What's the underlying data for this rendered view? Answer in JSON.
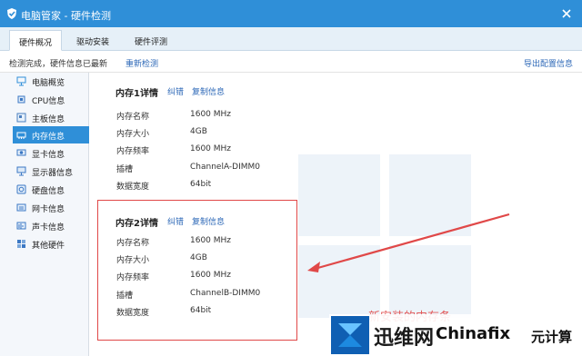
{
  "app": {
    "title": "电脑管家 - 硬件检测"
  },
  "tabs": [
    {
      "label": "硬件概况",
      "active": true
    },
    {
      "label": "驱动安装",
      "active": false
    },
    {
      "label": "硬件评测",
      "active": false
    }
  ],
  "status": {
    "text": "检测完成，硬件信息已最新",
    "rescan": "重新检测",
    "export": "导出配置信息"
  },
  "sidebar": {
    "items": [
      {
        "label": "电脑概览",
        "icon": "computer-icon"
      },
      {
        "label": "CPU信息",
        "icon": "cpu-icon"
      },
      {
        "label": "主板信息",
        "icon": "motherboard-icon"
      },
      {
        "label": "内存信息",
        "icon": "memory-icon",
        "active": true
      },
      {
        "label": "显卡信息",
        "icon": "gpu-icon"
      },
      {
        "label": "显示器信息",
        "icon": "monitor-icon"
      },
      {
        "label": "硬盘信息",
        "icon": "disk-icon"
      },
      {
        "label": "网卡信息",
        "icon": "network-card-icon"
      },
      {
        "label": "声卡信息",
        "icon": "sound-card-icon"
      },
      {
        "label": "其他硬件",
        "icon": "other-hardware-icon"
      }
    ]
  },
  "memory": [
    {
      "title": "内存1详情",
      "actions": {
        "correct": "纠错",
        "copy": "复制信息"
      },
      "rows": [
        {
          "label": "内存名称",
          "value": "1600 MHz"
        },
        {
          "label": "内存大小",
          "value": "4GB"
        },
        {
          "label": "内存频率",
          "value": "1600 MHz"
        },
        {
          "label": "插槽",
          "value": "ChannelA-DIMM0"
        },
        {
          "label": "数据宽度",
          "value": "64bit"
        }
      ]
    },
    {
      "title": "内存2详情",
      "actions": {
        "correct": "纠错",
        "copy": "复制信息"
      },
      "rows": [
        {
          "label": "内存名称",
          "value": "1600 MHz"
        },
        {
          "label": "内存大小",
          "value": "4GB"
        },
        {
          "label": "内存频率",
          "value": "1600 MHz"
        },
        {
          "label": "插槽",
          "value": "ChannelB-DIMM0"
        },
        {
          "label": "数据宽度",
          "value": "64bit"
        }
      ]
    }
  ],
  "annotation": {
    "text": "新安装的内存条"
  },
  "watermark": {
    "brand": "迅维网",
    "site": "Chinafix",
    "tail": "元计算"
  },
  "colors": {
    "title_bar": "#2f8fd8",
    "active_nav": "#2f8fd8",
    "link": "#2d68b7",
    "highlight": "#e04848"
  }
}
